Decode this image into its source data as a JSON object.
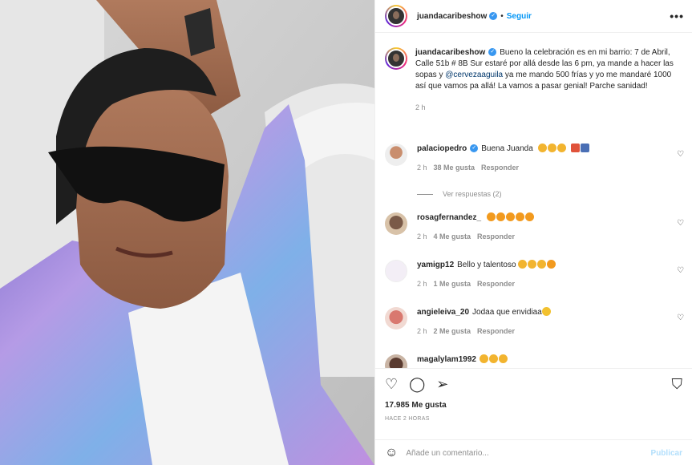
{
  "header": {
    "username": "juandacaribeshow",
    "follow_label": "Seguir",
    "separator": "•",
    "more_glyph": "•••"
  },
  "caption": {
    "username": "juandacaribeshow",
    "text_before": "Bueno la celebración es en mi barrio: 7 de Abril, Calle 51b # 8B Sur estaré por allá desde las 6 pm, ya mande a hacer las sopas y ",
    "mention": "@cervezaaguila",
    "text_after": " ya me mando 500 frías y yo me mandaré 1000 así que vamos pa allá! La vamos a pasar genial! Parche sanidad!",
    "time": "2 h"
  },
  "comments": [
    {
      "username": "palaciopedro",
      "text": "Buena Juanda",
      "time": "2 h",
      "likes": "38 Me gusta",
      "reply": "Responder",
      "view_replies": "Ver respuestas (2)"
    },
    {
      "username": "rosagfernandez_",
      "text": "",
      "time": "2 h",
      "likes": "4 Me gusta",
      "reply": "Responder"
    },
    {
      "username": "yamigp12",
      "text": "Bello y talentoso",
      "time": "2 h",
      "likes": "1 Me gusta",
      "reply": "Responder"
    },
    {
      "username": "angieleiva_20",
      "text": "Jodaa que envidiaa",
      "time": "2 h",
      "likes": "2 Me gusta",
      "reply": "Responder"
    },
    {
      "username": "magalylam1992",
      "text": ""
    }
  ],
  "footer": {
    "likes": "17.985 Me gusta",
    "timestamp": "HACE 2 HORAS",
    "comment_placeholder": "Añade un comentario...",
    "post_label": "Publicar"
  },
  "icons": {
    "heart": "♡",
    "comment": "◯",
    "share": "➢",
    "save": "⛉",
    "smile": "☺"
  },
  "colors": {
    "link_blue": "#0095f6",
    "verified_blue": "#3897f0",
    "muted": "#8e8e8e",
    "shirt_iridescent": "#a78bd8"
  }
}
